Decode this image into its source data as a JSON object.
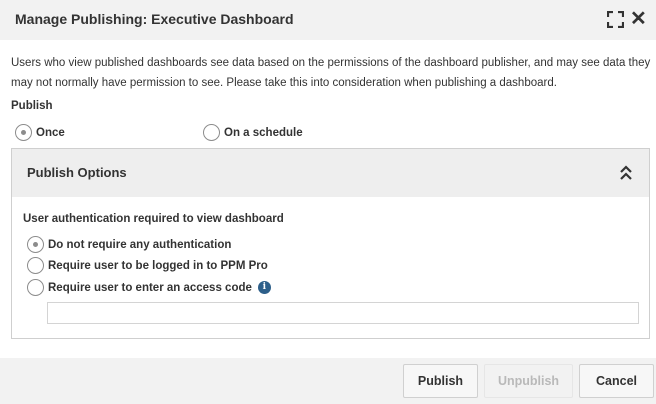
{
  "dialog": {
    "title": "Manage Publishing: Executive Dashboard",
    "expand_icon": "expand-icon",
    "close_icon": "close-icon",
    "close_glyph": "✕"
  },
  "notice": "Users who view published dashboards see data based on the permissions of the dashboard publisher, and may see data they may not normally have permission to see. Please take this into consideration when publishing a dashboard.",
  "publish": {
    "label": "Publish",
    "options": [
      {
        "label": "Once",
        "checked": true
      },
      {
        "label": "On a schedule",
        "checked": false
      }
    ]
  },
  "publish_options": {
    "title": "Publish Options",
    "collapse_icon": "chevron-double-up-icon",
    "auth_label": "User authentication required to view dashboard",
    "auth_options": [
      {
        "label": "Do not require any authentication",
        "checked": true
      },
      {
        "label": "Require user to be logged in to PPM Pro",
        "checked": false
      },
      {
        "label": "Require user to enter an access code",
        "checked": false
      }
    ],
    "info_glyph": "i",
    "access_code_value": ""
  },
  "footer": {
    "publish_label": "Publish",
    "unpublish_label": "Unpublish",
    "cancel_label": "Cancel"
  },
  "colors": {
    "header_bg": "#f2f2f2",
    "panel_header_bg": "#eeeeee",
    "info_icon": "#2d5f8a",
    "disabled_text": "#b9b9b9"
  }
}
